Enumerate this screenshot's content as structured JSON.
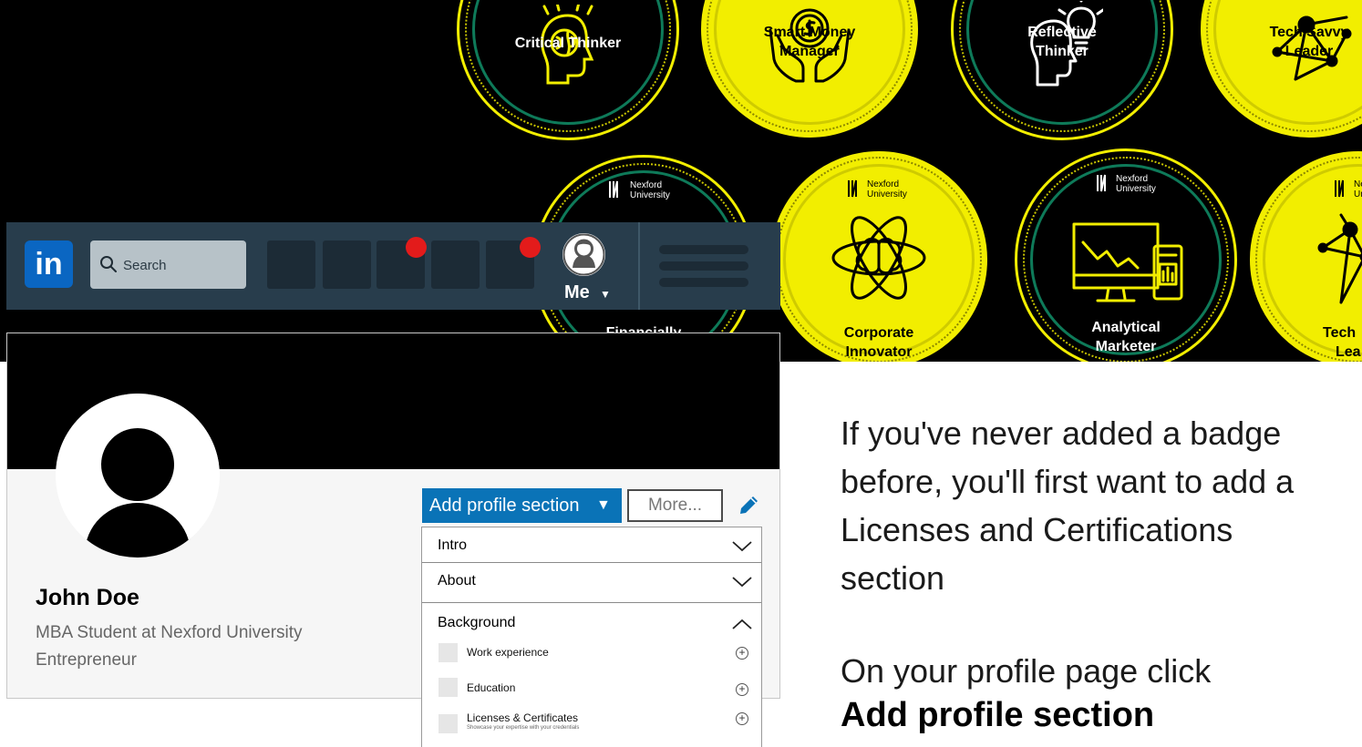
{
  "badges": {
    "critical_thinker": "Critical Thinker",
    "smart_money_1": "Smart Money",
    "smart_money_2": "Manager",
    "reflective_1": "Reflective",
    "reflective_2": "Thinker",
    "tech_savvy_1": "Tech Savvy",
    "tech_savvy_2": "Leader",
    "financially": "Financially",
    "corporate_1": "Corporate",
    "corporate_2": "Innovator",
    "analytical_1": "Analytical",
    "analytical_2": "Marketer",
    "tech_partial_1": "Tech",
    "tech_partial_2": "Lea",
    "logo_line1": "Nexford",
    "logo_line2": "University",
    "logo_partial_1": "Ne",
    "logo_partial_2": "Un"
  },
  "navbar": {
    "logo": "in",
    "search_placeholder": "Search",
    "me_label": "Me",
    "me_caret": "▼"
  },
  "profile": {
    "name": "John Doe",
    "headline_1": "MBA Student at Nexford University",
    "headline_2": "Entrepreneur",
    "add_section_label": "Add profile section",
    "add_section_caret": "▼",
    "more_label": "More..."
  },
  "dropdown": {
    "intro": "Intro",
    "about": "About",
    "background": "Background",
    "work_experience": "Work experience",
    "education": "Education",
    "licenses": "Licenses & Certificates",
    "licenses_sub": "Showcase your expertise with your credentials"
  },
  "instructions": {
    "para1": "If you've never added a badge before, you'll first want to add a Licenses and Certifications section",
    "para2": "On your profile page click",
    "para3": "Add profile section"
  },
  "colors": {
    "linkedin_blue": "#0a66c2",
    "badge_yellow": "#f2ee00",
    "navbar_bg": "#283d4c",
    "notification_red": "#e31b1b",
    "add_button_blue": "#0a73b7"
  }
}
